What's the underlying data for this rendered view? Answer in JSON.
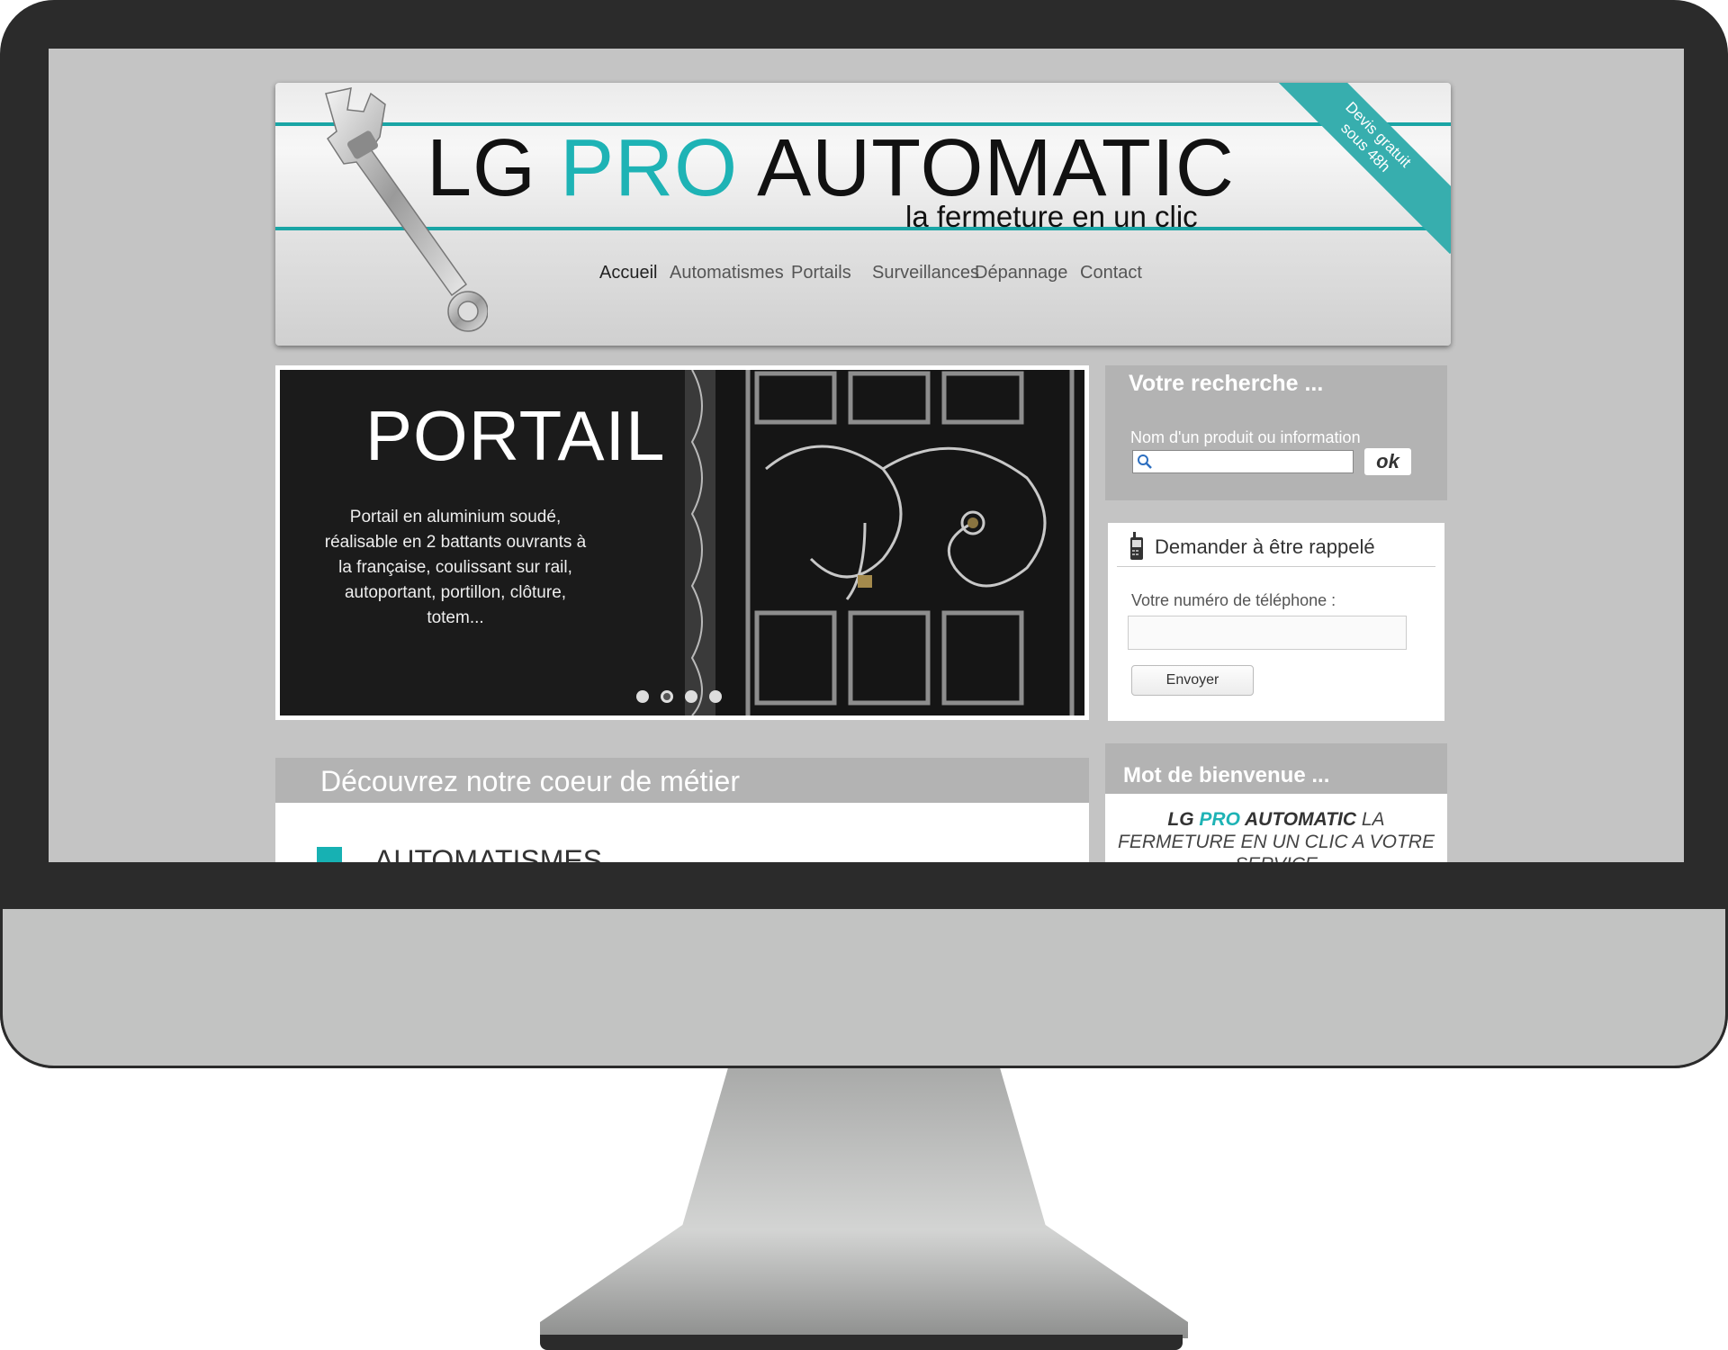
{
  "header": {
    "logo_part1": "LG ",
    "logo_part2": "PRO",
    "logo_part3": " AUTOMATIC",
    "tagline": "la fermeture en un clic",
    "ribbon_line1": "Devis gratuit",
    "ribbon_line2": "sous 48h"
  },
  "nav": {
    "items": [
      {
        "label": "Accueil",
        "active": true
      },
      {
        "label": "Automatismes"
      },
      {
        "label": "Portails"
      },
      {
        "label": "Surveillances"
      },
      {
        "label": "Dépannage"
      },
      {
        "label": "Contact"
      }
    ]
  },
  "slider": {
    "title": "PORTAIL",
    "description": "Portail en aluminium soudé, réalisable en 2 battants ouvrants à la française, coulissant sur rail, autoportant, portillon, clôture, totem...",
    "slide_count": 4,
    "active_index": 1
  },
  "section": {
    "heading": "Découvrez notre coeur de métier",
    "first_item": "AUTOMATISMES"
  },
  "search": {
    "title": "Votre recherche ...",
    "label": "Nom d'un produit ou information",
    "value": "",
    "button": "ok"
  },
  "callback": {
    "title": "Demander à être rappelé",
    "label": "Votre numéro de téléphone :",
    "value": "",
    "button": "Envoyer"
  },
  "welcome": {
    "heading": "Mot de bienvenue ...",
    "brand_lg": "LG ",
    "brand_pro": "PRO",
    "brand_auto": " AUTOMATIC",
    "text": " LA FERMETURE EN UN CLIC A VOTRE SERVICE"
  },
  "colors": {
    "accent": "#1eb3b5",
    "panel_grey": "#b3b3b3",
    "bezel": "#2b2b2b"
  }
}
